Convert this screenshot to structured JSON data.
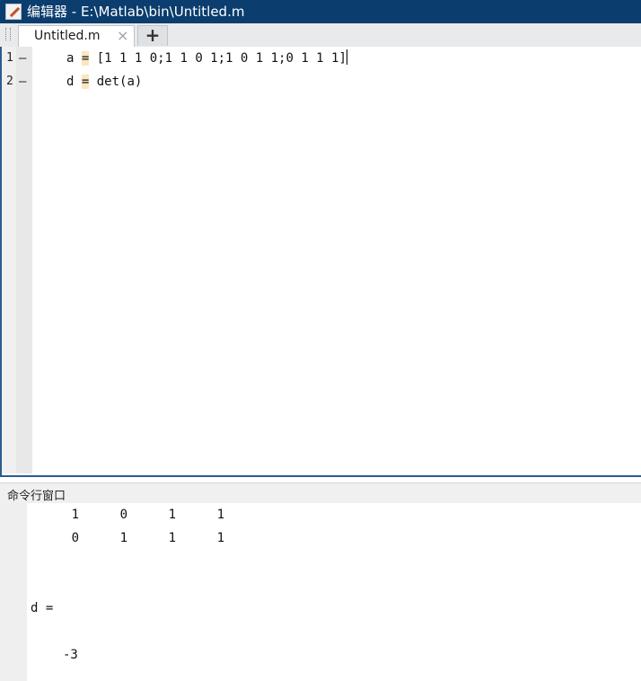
{
  "editor_window": {
    "title": "编辑器 - E:\\Matlab\\bin\\Untitled.m",
    "tab_label": "Untitled.m",
    "tab_close": "×",
    "add_tab": "+"
  },
  "code_lines": [
    {
      "number": "1",
      "marker": "—",
      "lhs": "a",
      "eq": "=",
      "rhs": "[1 1 1 0;1 1 0 1;1 0 1 1;0 1 1 1]"
    },
    {
      "number": "2",
      "marker": "—",
      "lhs": "d",
      "eq": "=",
      "rhs": "det(a)"
    }
  ],
  "command_window": {
    "title": "命令行窗口",
    "matrix_rows": [
      [
        "1",
        "0",
        "1",
        "1"
      ],
      [
        "0",
        "1",
        "1",
        "1"
      ]
    ],
    "result_label": "d =",
    "result_value": "-3"
  },
  "colors": {
    "title_bar": "#0b3d6e",
    "equals_highlight": "#fbe6bd",
    "editor_border": "#2a5c8e"
  }
}
